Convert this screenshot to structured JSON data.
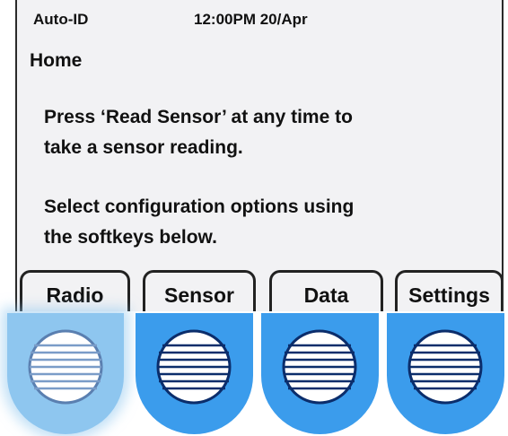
{
  "status_bar": {
    "left_label": "Auto-ID",
    "datetime": "12:00PM 20/Apr"
  },
  "page": {
    "title": "Home",
    "messages": [
      "Press ‘Read Sensor’ at any time to\ntake a sensor reading.",
      "Select configuration options using\nthe softkeys below."
    ]
  },
  "softkeys": [
    {
      "label": "Radio"
    },
    {
      "label": "Sensor"
    },
    {
      "label": "Data"
    },
    {
      "label": "Settings"
    }
  ],
  "colors": {
    "button_blue": "#3b9cec",
    "button_pressed": "#8ec6ef",
    "grille_navy": "#0b2d6b"
  },
  "hardware_buttons": [
    {
      "icon": "grille-icon",
      "pressed": true
    },
    {
      "icon": "grille-icon",
      "pressed": false
    },
    {
      "icon": "grille-icon",
      "pressed": false
    },
    {
      "icon": "grille-icon",
      "pressed": false
    }
  ]
}
